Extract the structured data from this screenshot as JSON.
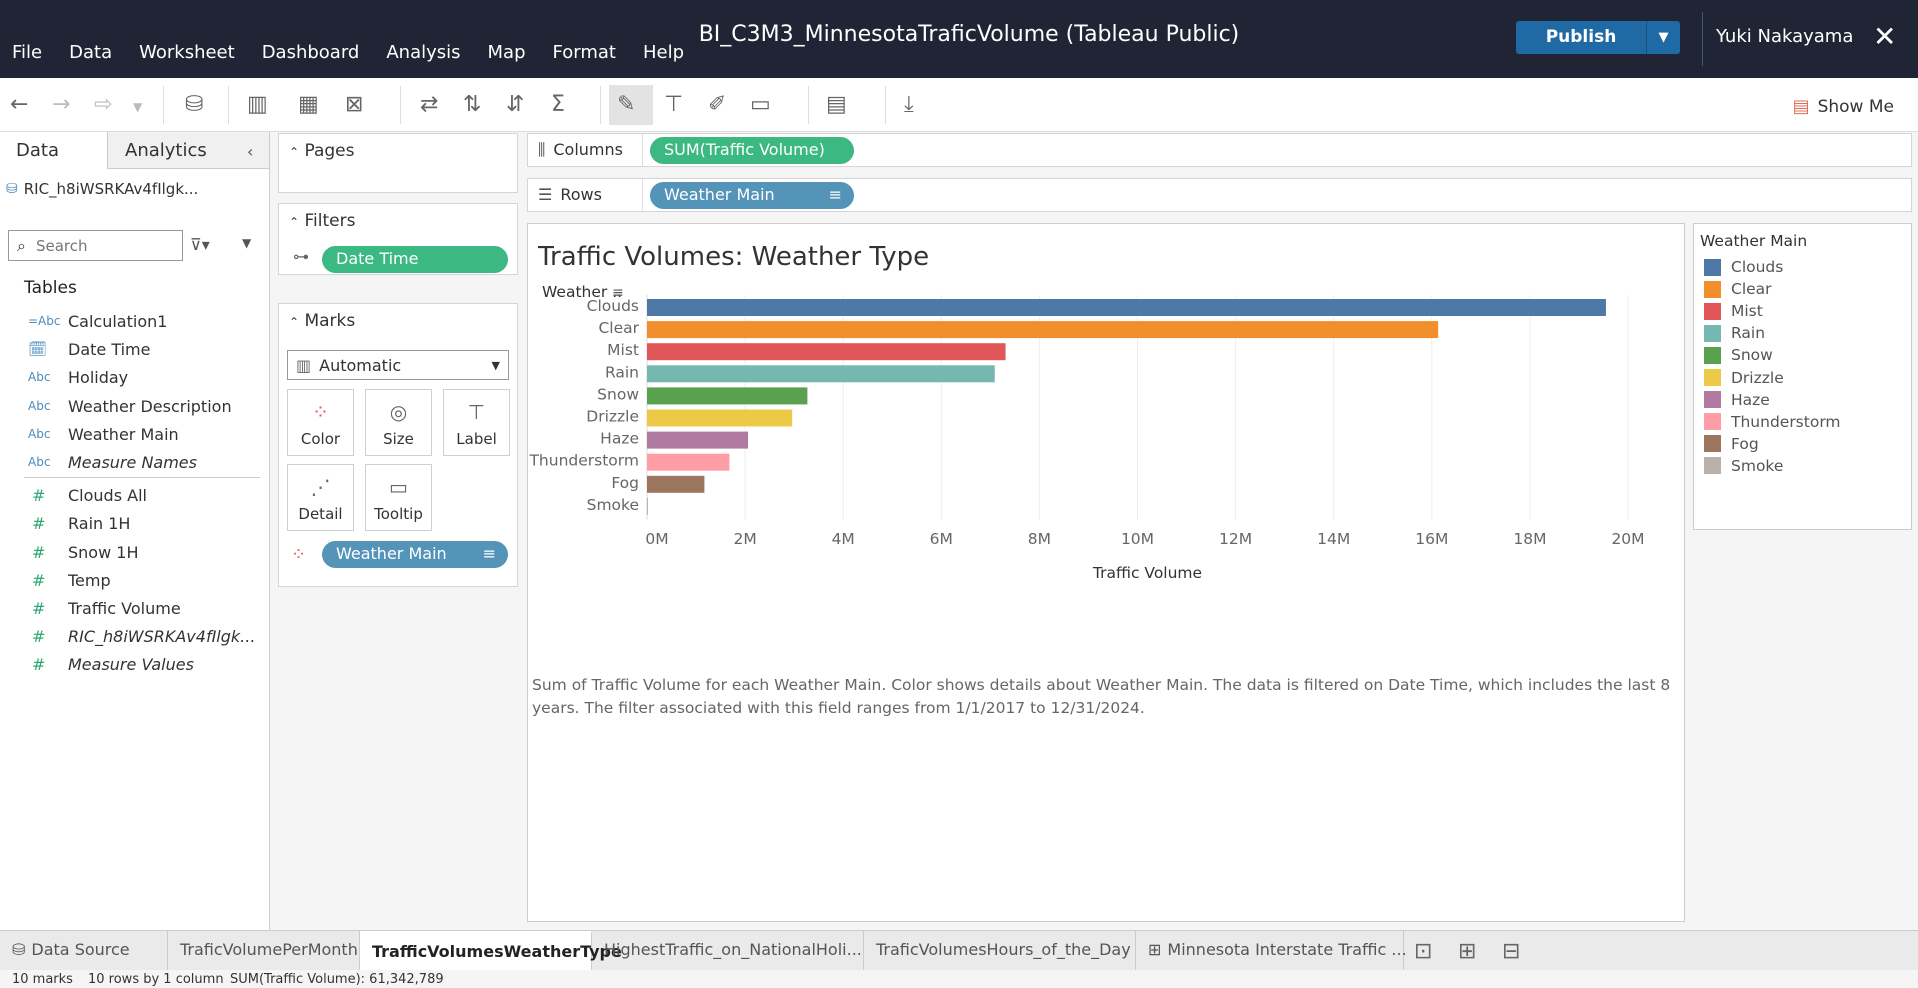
{
  "window": {
    "title": "BI_C3M3_MinnesotaTraficVolume (Tableau Public)",
    "publish_label": "Publish",
    "user": "Yuki Nakayama"
  },
  "menu": [
    "File",
    "Data",
    "Worksheet",
    "Dashboard",
    "Analysis",
    "Map",
    "Format",
    "Help"
  ],
  "toolbar": {
    "show_me": "Show Me"
  },
  "datapane": {
    "tab_data": "Data",
    "tab_analytics": "Analytics",
    "datasource": "RIC_h8iWSRKAv4fIlgk...",
    "search_placeholder": "Search",
    "tables_heading": "Tables",
    "dimensions": [
      {
        "type": "=Abc",
        "name": "Calculation1"
      },
      {
        "type": "date",
        "name": "Date Time"
      },
      {
        "type": "Abc",
        "name": "Holiday"
      },
      {
        "type": "Abc",
        "name": "Weather Description"
      },
      {
        "type": "Abc",
        "name": "Weather Main"
      },
      {
        "type": "Abc",
        "name": "Measure Names"
      }
    ],
    "measures": [
      {
        "type": "#",
        "name": "Clouds All"
      },
      {
        "type": "#",
        "name": "Rain 1H"
      },
      {
        "type": "#",
        "name": "Snow 1H"
      },
      {
        "type": "#",
        "name": "Temp"
      },
      {
        "type": "#",
        "name": "Traffic Volume"
      },
      {
        "type": "#",
        "name": "RIC_h8iWSRKAv4fIlgk..."
      },
      {
        "type": "#",
        "name": "Measure Values"
      }
    ]
  },
  "cards": {
    "pages": "Pages",
    "filters": "Filters",
    "filter_pill": "Date Time",
    "marks": "Marks",
    "mark_type": "Automatic",
    "mark_buttons": [
      "Color",
      "Size",
      "Label",
      "Detail",
      "Tooltip"
    ],
    "color_pill": "Weather Main"
  },
  "shelves": {
    "columns_label": "Columns",
    "columns_pill": "SUM(Traffic Volume)",
    "rows_label": "Rows",
    "rows_pill": "Weather Main"
  },
  "view": {
    "title": "Traffic Volumes: Weather Type",
    "caption": "Sum of Traffic Volume for each Weather Main.  Color shows details about Weather Main. The data is filtered on Date Time, which includes the last 8 years. The filter associated with this field ranges from 1/1/2017 to 12/31/2024."
  },
  "chart_data": {
    "type": "bar",
    "orientation": "horizontal",
    "row_header": "Weather ..",
    "categories": [
      "Clouds",
      "Clear",
      "Mist",
      "Rain",
      "Snow",
      "Drizzle",
      "Haze",
      "Thunderstorm",
      "Fog",
      "Smoke"
    ],
    "values": [
      19550000,
      16130000,
      7310000,
      7090000,
      3270000,
      2960000,
      2060000,
      1680000,
      1170000,
      20000
    ],
    "colors": [
      "#4e79a7",
      "#f28e2b",
      "#e15759",
      "#76b7b2",
      "#59a14f",
      "#edc948",
      "#b07aa1",
      "#ff9da7",
      "#9c755f",
      "#bab0ac"
    ],
    "xlabel": "Traffic Volume",
    "xticks": [
      "0M",
      "2M",
      "4M",
      "6M",
      "8M",
      "10M",
      "12M",
      "14M",
      "16M",
      "18M",
      "20M"
    ],
    "xlim": [
      0,
      20000000
    ],
    "grid": true
  },
  "legend": {
    "title": "Weather Main"
  },
  "sheet_tabs": [
    "Data Source",
    "TraficVolumePerMonth",
    "TrafficVolumesWeatherType",
    "HighestTraffic_on_NationalHoli...",
    "TraficVolumesHours_of_the_Day",
    "Minnesota Interstate Traffic ..."
  ],
  "active_tab": 2,
  "status": {
    "marks": "10 marks",
    "rows": "10 rows by 1 column",
    "sum": "SUM(Traffic Volume): 61,342,789"
  }
}
